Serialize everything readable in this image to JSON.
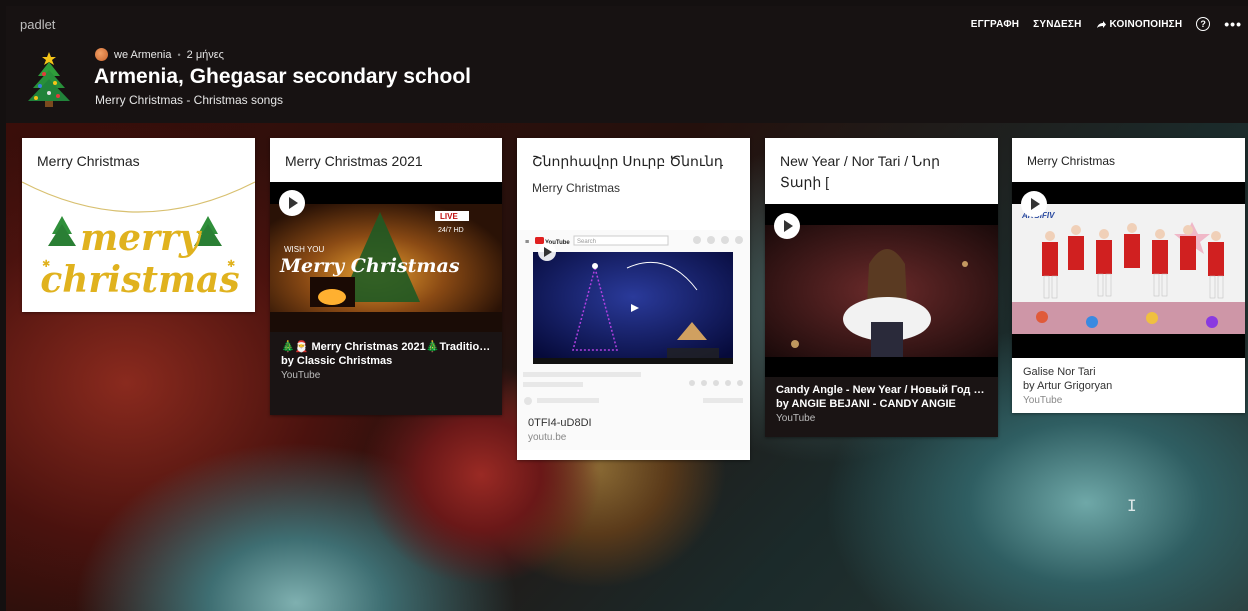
{
  "header": {
    "brand": "padlet",
    "nav": {
      "signup": "ΕΓΓΡΑΦΗ",
      "login": "ΣΥΝΔΕΣΗ",
      "share": "ΚΟΙΝΟΠΟΙΗΣΗ",
      "help": "?",
      "more": "•••"
    },
    "author": "we Armenia",
    "time_ago": "2 μήνες",
    "title": "Armenia, Ghegasar secondary school",
    "subtitle": "Merry Christmas - Christmas songs"
  },
  "cards": [
    {
      "title": "Merry Christmas",
      "image_text_1": "merry",
      "image_text_2": "christmas"
    },
    {
      "title": "Merry Christmas 2021",
      "thumb_live": "LIVE",
      "thumb_hd": "24/7 HD",
      "thumb_wish": "WISH YOU",
      "thumb_merry": "Merry Christmas",
      "att_title": "🎄🎅 Merry Christmas 2021🎄Tradition...",
      "att_by": "by Classic Christmas",
      "att_src": "YouTube"
    },
    {
      "title": "Շնորհավոր Սուրբ Ծնունդ",
      "subtitle": "Merry Christmas",
      "yt_logo": "YouTube",
      "yt_search": "Search",
      "att_title": "0TFI4-uD8DI",
      "att_src": "youtu.be"
    },
    {
      "title": "New Year / Nor Tari / Նոր Տարի [",
      "att_title": "Candy Angle - New Year / Новый Год / ...",
      "att_by": "by ANGIE BEJANI - CANDY ANGIE",
      "att_src": "YouTube"
    },
    {
      "title": "Merry Christmas",
      "thumb_brand": "ARGIFIV",
      "att_title": "Galise Nor Tari",
      "att_by": "by Artur Grigoryan",
      "att_src": "YouTube"
    }
  ],
  "colors": {
    "header_bg": "#171212",
    "card_bg": "#ffffff",
    "dark_attachment_bg": "#1a1414",
    "gold": "#e0b21e"
  }
}
